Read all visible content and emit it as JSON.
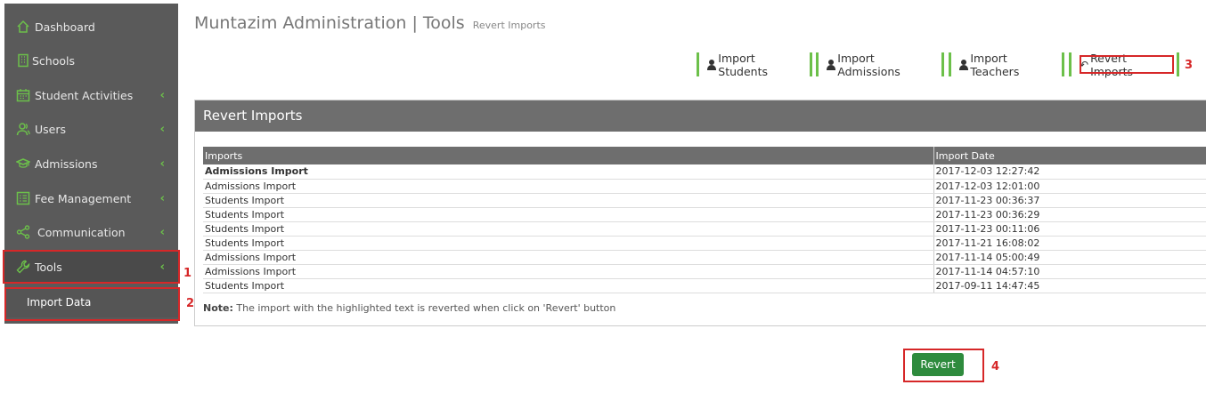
{
  "sidebar": {
    "items": [
      {
        "label": "Dashboard",
        "icon": "home-icon"
      },
      {
        "label": "Schools",
        "icon": "building-icon"
      },
      {
        "label": "Student Activities",
        "icon": "calendar-icon"
      },
      {
        "label": "Users",
        "icon": "users-icon"
      },
      {
        "label": "Admissions",
        "icon": "graduation-cap-icon"
      },
      {
        "label": "Fee Management",
        "icon": "list-icon"
      },
      {
        "label": "Communication",
        "icon": "share-icon"
      },
      {
        "label": "Tools",
        "icon": "wrench-icon"
      }
    ],
    "subitem": "Import Data",
    "chevron": "‹"
  },
  "header": {
    "title": "Muntazim Administration | Tools",
    "subtitle": "Revert Imports"
  },
  "toolbar": {
    "buttons": [
      {
        "label": "Import Students",
        "icon": "user-icon"
      },
      {
        "label": "Import Admissions",
        "icon": "user-icon"
      },
      {
        "label": "Import Teachers",
        "icon": "user-icon"
      },
      {
        "label": "Revert Imports",
        "icon": "undo-icon"
      }
    ]
  },
  "panel": {
    "title": "Revert Imports",
    "columns": [
      "Imports",
      "Import Date"
    ],
    "rows": [
      {
        "import": "Admissions Import",
        "date": "2017-12-03 12:27:42"
      },
      {
        "import": "Admissions Import",
        "date": "2017-12-03 12:01:00"
      },
      {
        "import": "Students Import",
        "date": "2017-11-23 00:36:37"
      },
      {
        "import": "Students Import",
        "date": "2017-11-23 00:36:29"
      },
      {
        "import": "Students Import",
        "date": "2017-11-23 00:11:06"
      },
      {
        "import": "Students Import",
        "date": "2017-11-21 16:08:02"
      },
      {
        "import": "Admissions Import",
        "date": "2017-11-14 05:00:49"
      },
      {
        "import": "Admissions Import",
        "date": "2017-11-14 04:57:10"
      },
      {
        "import": "Students Import",
        "date": "2017-09-11 14:47:45"
      }
    ],
    "note_label": "Note:",
    "note_text": " The import with the highlighted text is reverted when click on 'Revert' button"
  },
  "revert_button": "Revert",
  "annotations": [
    "1",
    "2",
    "3",
    "4"
  ],
  "colors": {
    "accent": "#6cc04a",
    "sidebar": "#5a5a5a",
    "header_bar": "#6e6e6e",
    "primary_button": "#2e8b3d",
    "highlight": "#d62728"
  }
}
